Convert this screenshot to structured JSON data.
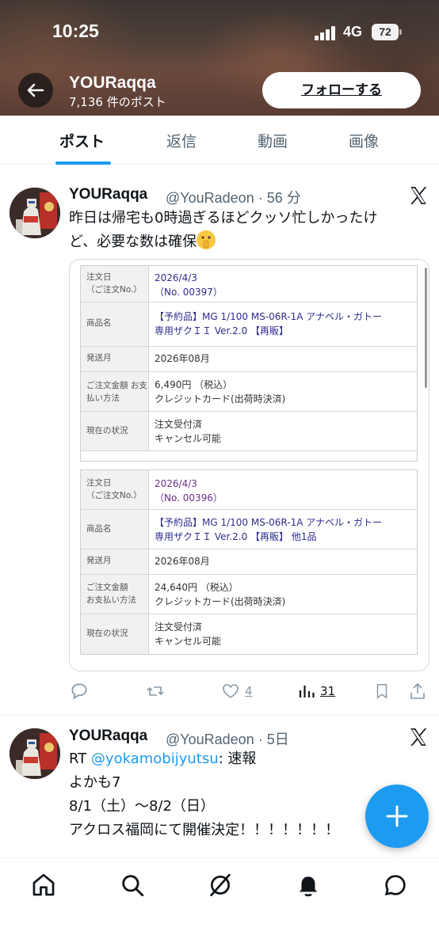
{
  "status_bar": {
    "time": "10:25",
    "network": "4G",
    "battery": "72"
  },
  "header": {
    "profile_name": "YOURaqqa",
    "post_count": "7,136 件のポスト",
    "follow_label": "フォローする"
  },
  "tabs": [
    {
      "label": "ポスト",
      "active": true
    },
    {
      "label": "返信",
      "active": false
    },
    {
      "label": "動画",
      "active": false
    },
    {
      "label": "画像",
      "active": false
    }
  ],
  "tweets": [
    {
      "name": "YOURaqqa",
      "handle_time": "@YouRadeon · 56 分",
      "text_line1": "昨日は帰宅も0時過ぎるほどクッソ忙しかったけ",
      "text_line2": "ど、必要な数は確保",
      "emoji": "shushing-face-emoji",
      "orders": [
        {
          "label_order": "注文日\n（ご注文No.）",
          "date": "2026/4/3",
          "order_no": "（No. 00397）",
          "label_product": "商品名",
          "product_line1": "【予約品】MG 1/100 MS-06R-1A アナベル・ガトー",
          "product_line2": "専用ザクＩＩ Ver.2.0 【再販】",
          "label_ship": "発送月",
          "ship": "2026年08月",
          "label_amount": "ご注文金額\nお支払い方法",
          "amount": "6,490円 （税込）",
          "payment": "クレジットカード(出荷時決済)",
          "label_status": "現在の状況",
          "status1": "注文受付済",
          "status2": "キャンセル可能"
        },
        {
          "label_order": "注文日\n（ご注文No.）",
          "date": "2026/4/3",
          "order_no": "（No. 00396）",
          "label_product": "商品名",
          "product_line1": "【予約品】MG 1/100 MS-06R-1A アナベル・ガトー",
          "product_line2": "専用ザクＩＩ Ver.2.0 【再販】 他1品",
          "label_ship": "発送月",
          "ship": "2026年08月",
          "label_amount": "ご注文金額\nお支払い方法",
          "amount": "24,640円 （税込）",
          "payment": "クレジットカード(出荷時決済)",
          "label_status": "現在の状況",
          "status1": "注文受付済",
          "status2": "キャンセル可能"
        }
      ],
      "actions": {
        "replies": "",
        "retweets": "",
        "likes": "4",
        "views": "31"
      }
    },
    {
      "name": "YOURaqqa",
      "handle_time": "@YouRadeon · 5日",
      "rt_prefix": "RT ",
      "rt_mention": "@yokamobijyutsu",
      "rt_suffix": ": 速報",
      "line2": "よかも7",
      "line3": "8/1（土）〜8/2（日）",
      "line4": "アクロス福岡にて開催決定！！！！！！！"
    }
  ],
  "icons": [
    "back-arrow-icon",
    "x-logo-icon",
    "reply-icon",
    "retweet-icon",
    "like-icon",
    "views-icon",
    "bookmark-icon",
    "share-icon",
    "compose-plus-icon",
    "home-icon",
    "search-icon",
    "grok-icon",
    "notifications-icon",
    "messages-icon"
  ],
  "colors": {
    "accent": "#1d9bf0",
    "text": "#0f1419",
    "secondary": "#536471"
  }
}
